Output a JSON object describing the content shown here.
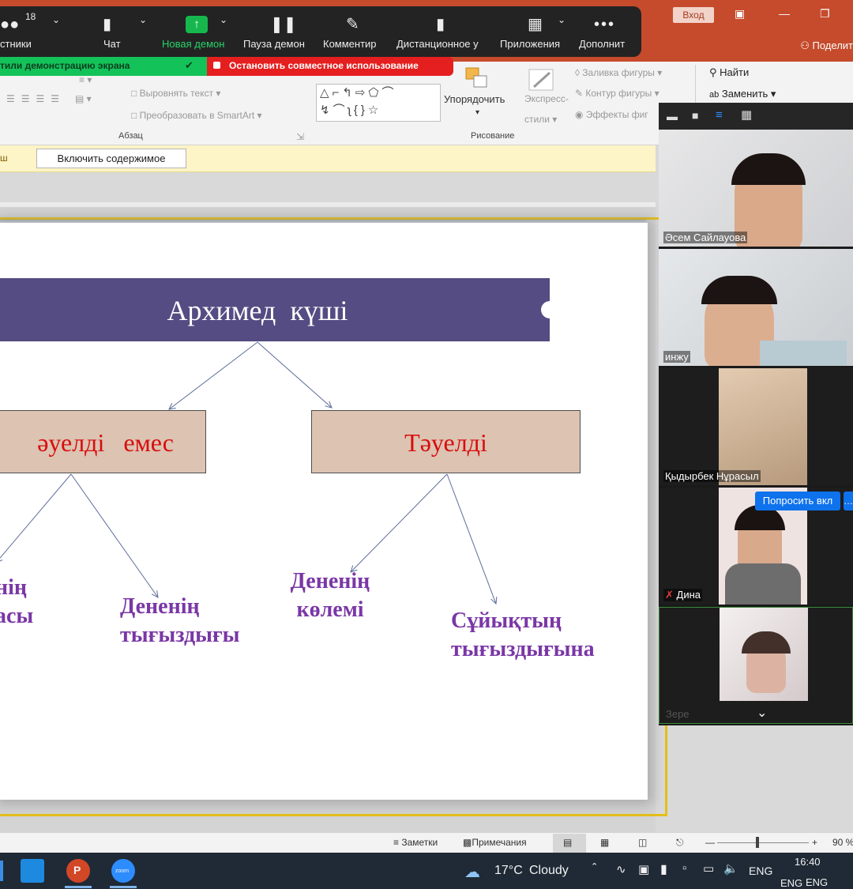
{
  "zoom_toolbar": {
    "participants_count": "18",
    "participants_label": "стники",
    "chat_label": "Чат",
    "new_share_label": "Новая демон",
    "pause_share_label": "Пауза демон",
    "annotate_label": "Комментир",
    "remote_control_label": "Дистанционное у",
    "apps_label": "Приложения",
    "more_label": "Дополнит"
  },
  "share_status": {
    "sharing_text": "тили демонстрацию экрана",
    "stop_share_label": "Остановить совместное использование"
  },
  "ppt_window": {
    "enter_label": "Вход",
    "share_label": "Поделит"
  },
  "ribbon": {
    "align_text_label": "Выровнять текст",
    "convert_smartart_label": "Преобразовать в SmartArt",
    "paragraph_group_label": "Абзац",
    "arrange_label": "Упорядочить",
    "quick_styles_label_1": "Экспресс-",
    "quick_styles_label_2": "стили",
    "shape_fill_label": "Заливка фигуры",
    "shape_outline_label": "Контур фигуры",
    "shape_effects_label": "Эффекты фиг",
    "drawing_group_label": "Рисование",
    "find_label": "Найти",
    "replace_label": "Заменить"
  },
  "protected_view": {
    "tag_text": "ш",
    "enable_content_label": "Включить содержимое"
  },
  "slide": {
    "title": "Архимед  күші",
    "left_box": "әуелді   емес",
    "right_box": "Тәуелді",
    "leaf_1_line1": "нің",
    "leaf_1_line2": "асы",
    "leaf_2_line1": "Дененің",
    "leaf_2_line2": "тығыздығы",
    "leaf_3_line1": "Дененің",
    "leaf_3_line2": "көлемі",
    "leaf_4_line1": "Сұйықтың",
    "leaf_4_line2": "тығыздығына"
  },
  "status_bar": {
    "notes_label": "Заметки",
    "comments_label": "Примечания",
    "zoom_level": "90 %"
  },
  "gallery": {
    "participants": [
      {
        "name": "Әсем Сайлауова"
      },
      {
        "name": "инжу"
      },
      {
        "name": "Қыдырбек Нұрасыл"
      },
      {
        "name": "Дина"
      },
      {
        "name": "Зере"
      }
    ],
    "ask_unmute_label": "Попросить вкл"
  },
  "taskbar": {
    "weather_temp": "17°C",
    "weather_text": "Cloudy",
    "lang_label": "ENG",
    "time": "16:40",
    "lang_label_2": "ENG"
  }
}
